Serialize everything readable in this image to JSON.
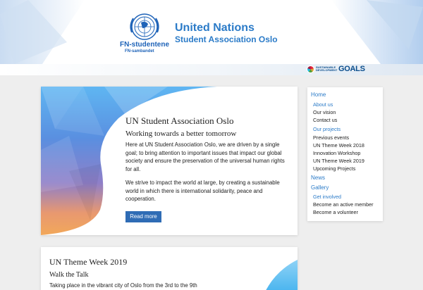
{
  "header": {
    "logo_main": "FN-studentene",
    "logo_sub": "FN-sambandet",
    "title": "United Nations",
    "subtitle": "Student Association Oslo"
  },
  "sdg": {
    "small": "SUSTAINABLE DEVELOPMENT",
    "big": "GOALS"
  },
  "featured": {
    "title": "UN Student Association Oslo",
    "subtitle": "Working towards a better tomorrow",
    "p1": "Here at UN Student Association Oslo, we are driven by a single goal; to bring attention to important issues that impact our global society and ensure the preservation of the universal human rights for all.",
    "p2": "We strive to impact the world at large, by creating a sustainable world in which there is international solidarity, peace and cooperation.",
    "button": "Read more"
  },
  "second": {
    "title": "UN Theme Week 2019",
    "subtitle": "Walk the Talk",
    "p": "Taking place in the vibrant city of Oslo from the 3rd to the 9th"
  },
  "nav": {
    "home": "Home",
    "about": "About us",
    "vision": "Our vision",
    "contact": "Contact us",
    "projects": "Our projects",
    "previous": "Previous events",
    "tw2018": "UN Theme Week 2018",
    "innovation": "Innovation Workshop",
    "tw2019": "UN Theme Week 2019",
    "upcoming": "Upcoming Projects",
    "news": "News",
    "gallery": "Gallery",
    "involved": "Get involved",
    "member": "Become an active member",
    "volunteer": "Become a volunteer"
  },
  "colors": {
    "accent": "#2b7bc8",
    "button": "#2f6cb5"
  }
}
